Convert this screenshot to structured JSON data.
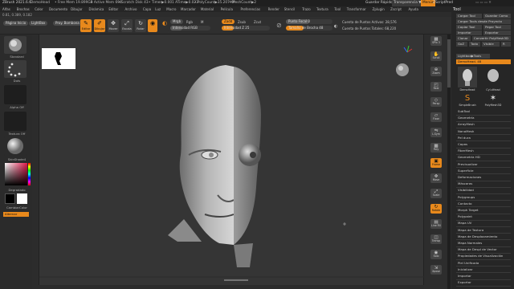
{
  "titlebar": {
    "app": "ZBrush 2021.6.6",
    "doc": "DemoHead",
    "free_mem": "• Free Mem 19.899GB",
    "active_mem": "• Active Mem 694",
    "scratch": "• Scratch Disk 43",
    "timer": "• Timer▶0.001 ATime▶0.023",
    "polycount": "• PolyCount▶35.207 KP",
    "meshcount": "• MeshCount▶2",
    "quicksave": "Guardar Rápido",
    "transparency": "Transparencia ▼",
    "menus_button": "Menús",
    "script": "ZScriptPred"
  },
  "menubar": [
    "Alfas",
    "Brochas",
    "Color",
    "Documento",
    "Dibujar",
    "Dinámica",
    "Editar",
    "Archivo",
    "Capa",
    "Luz",
    "Macro",
    "Marcador",
    "Material",
    "Película",
    "Preferencias",
    "Render",
    "Stencil",
    "Trazo",
    "Textura",
    "Tool",
    "Transformar",
    "Zplugin",
    "Zscript",
    "Ayuda"
  ],
  "statusline": "0.81, 0.389, 0.182",
  "toolbar": {
    "home": "Página Inicio",
    "lightbox": "LightBox",
    "proj": "Proy. Bombona",
    "buttons": [
      "Editar",
      "Dibujar",
      "Mover",
      "Escala",
      "Rotar"
    ],
    "mrgb": "Mrgb",
    "rgb": "Rgb",
    "m": "M",
    "zadd": "Zadd",
    "zsub": "Zsub",
    "zcut": "Zcut",
    "intensity_label": "Intensidad Z 25",
    "rgb_intensity": "Intensidad RGB",
    "focal_label": "Punto Focal 0",
    "brush_size_label": "Tamaño de Brocha 48",
    "active_points": "Cuenta de Puntos Activos: 28,576",
    "total_points": "Cuenta de Puntos Totales: 68,220"
  },
  "leftshelf": {
    "brush_name": "Standard",
    "stroke_name": "Dots",
    "alpha_name": "Alpha Off",
    "texture_name": "Textura Off",
    "material_name": "SkinShade4",
    "gradient_label": "Degradado",
    "switch_label": "CambiarColor",
    "alternate_label": "Alternar"
  },
  "rightdock": [
    {
      "label": "SPix 3",
      "icon": "grid-icon"
    },
    {
      "label": "Scroll",
      "icon": "hand-icon"
    },
    {
      "label": "Zoom",
      "icon": "magnify-icon"
    },
    {
      "label": "Real",
      "icon": "aa-icon"
    },
    {
      "label": "Persp",
      "icon": "persp-icon"
    },
    {
      "label": "Floor",
      "icon": "floor-icon"
    },
    {
      "label": "L.Sym",
      "icon": "sym-icon"
    },
    {
      "label": "Poly",
      "icon": "poly-icon"
    },
    {
      "label": "Frame",
      "icon": "frame-icon"
    },
    {
      "label": "Move",
      "icon": "move-icon"
    },
    {
      "label": "Scale",
      "icon": "scale-icon"
    },
    {
      "label": "Rotate",
      "icon": "rotate-icon"
    },
    {
      "label": "Line Fill",
      "icon": "linefill-icon"
    },
    {
      "label": "Transp",
      "icon": "transp-icon"
    },
    {
      "label": "Solo",
      "icon": "solo-icon"
    },
    {
      "label": "Xpose",
      "icon": "xpose-icon"
    }
  ],
  "toolpanel": {
    "title": "Tool",
    "load": "Cargar Tool",
    "save": "Guardar Como",
    "load_project": "Cargar Tools desde Proyecto",
    "copy": "Copiar Tool",
    "paste": "Pegar Tool",
    "import": "Importar",
    "export": "Exportar",
    "clone": "Clonar",
    "make_polymesh": "Convertir PolyMesh3D",
    "goz": "GoZ",
    "all": "Todo",
    "visible": "Visible",
    "r": "R",
    "lightbox_tools": "Lightbox▶Tools",
    "current": "DemoHead. 48",
    "thumbs": [
      "DemoHead",
      "Cyl.dHead",
      "SimpleBrush",
      "PolyMesh3D"
    ],
    "items": [
      "SubTool",
      "Geometría",
      "ArrayMesh",
      "NanoMesh",
      "Pel dura",
      "Capas",
      "FiberMesh",
      "Geometría HD",
      "Previsualizar",
      "Superficie",
      "Deformaciones",
      "Máscaras",
      "Visibilidad",
      "Polygroups",
      "Contacto",
      "Morph Target",
      "Polypaint",
      "Mapa UV",
      "Mapa de Textura",
      "Mapa de Desplazamiento",
      "Mapa Normales",
      "Mapa de Despl de Vector",
      "Propiedades de Visualización",
      "Piel Unificada",
      "Inicializar",
      "Importar",
      "Exportar"
    ]
  },
  "colors": {
    "accent": "#e8891c",
    "panel": "#262626",
    "canvas": "#353535"
  }
}
